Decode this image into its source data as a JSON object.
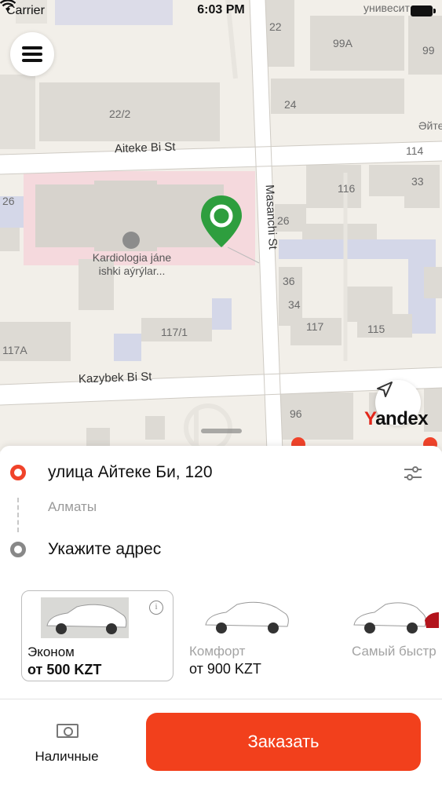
{
  "status_bar": {
    "carrier": "Carrier",
    "time": "6:03 PM"
  },
  "map": {
    "streets": {
      "aiteke": "Aiteke Bi St",
      "masanchi": "Masanchi St",
      "kazybek": "Kazybek Bi St",
      "top_right_fragment": "Әйте",
      "university_fragment": "униве­сит"
    },
    "poi": {
      "name": "Kardiologia jáne ishki aýrýlar..."
    },
    "buildings": {
      "b22": "22",
      "b99a": "99А",
      "b99": "99",
      "b22_2": "22/2",
      "b24": "24",
      "b114": "114",
      "b116": "116",
      "b33": "33",
      "b26_left": "26",
      "b26": "26",
      "b36": "36",
      "b34": "34",
      "b117": "117",
      "b115": "115",
      "b117_1": "117/1",
      "b117a": "117А",
      "b96": "96"
    },
    "logo": "Yandex",
    "pin_color": "#2e9e3e"
  },
  "route": {
    "from_address": "улица Айтеке Би, 120",
    "city": "Алматы",
    "to_placeholder": "Укажите адрес"
  },
  "tariffs": [
    {
      "name": "Эконом",
      "price": "от 500 KZT",
      "selected": true
    },
    {
      "name": "Комфорт",
      "price": "от 900 KZT",
      "selected": false
    },
    {
      "name": "Самый быстр",
      "price": "",
      "selected": false
    }
  ],
  "payment": {
    "label": "Наличные",
    "icon": "cash-icon"
  },
  "order_button": {
    "label": "Заказать",
    "color": "#f2401c"
  },
  "accent_color": "#f0432a"
}
